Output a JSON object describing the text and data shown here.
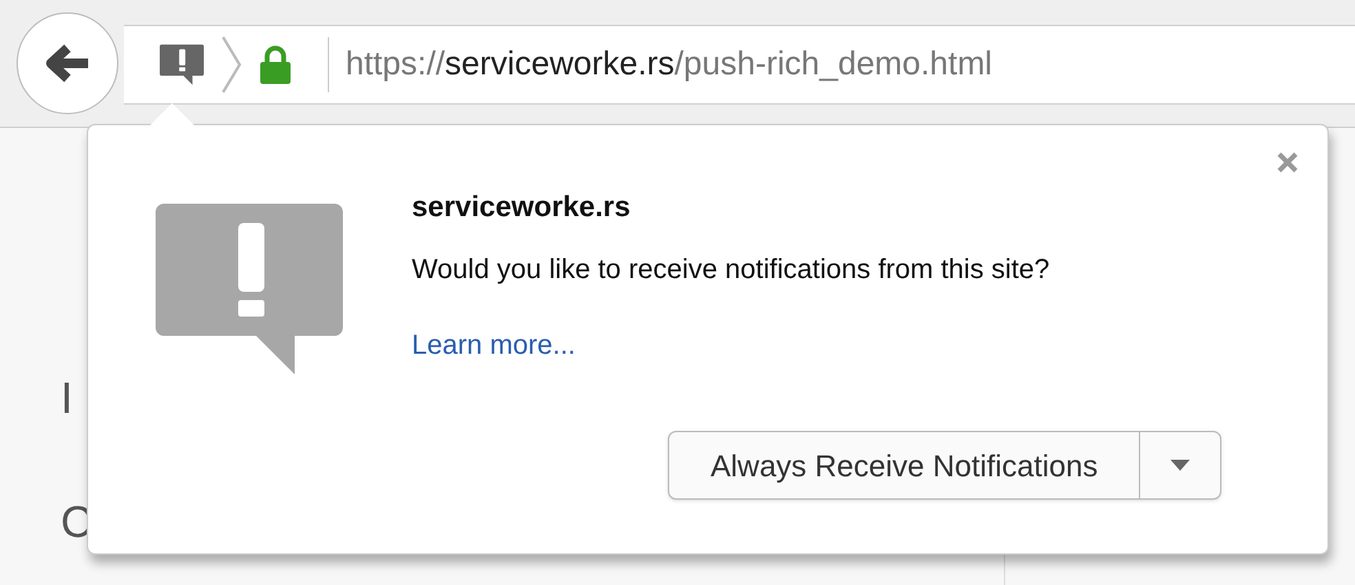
{
  "toolbar": {
    "url_scheme": "https://",
    "url_host": "serviceworke.rs",
    "url_path": "/push-rich_demo.html"
  },
  "page": {
    "nav": [
      "I",
      "C"
    ]
  },
  "popup": {
    "title": "serviceworke.rs",
    "message": "Would you like to receive notifications from this site?",
    "link": "Learn more...",
    "button": "Always Receive Notifications"
  }
}
